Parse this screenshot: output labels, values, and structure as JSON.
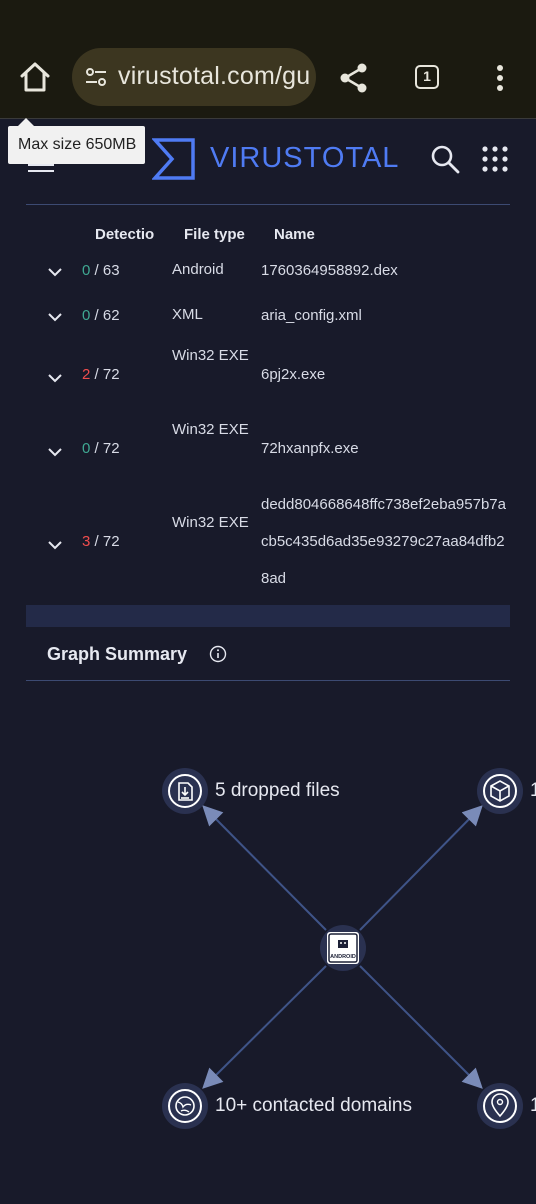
{
  "browser": {
    "url": "virustotal.com/gu",
    "tab_count": "1"
  },
  "tooltip": {
    "text": "Max size 650MB"
  },
  "header": {
    "logo_text": "VIRUSTOTAL"
  },
  "table": {
    "headers": {
      "detection": "Detectio",
      "file_type": "File type",
      "name": "Name"
    },
    "rows": [
      {
        "detections": "0",
        "total": " / 63",
        "file_type": "Android",
        "name": "1760364958892.dex"
      },
      {
        "detections": "0",
        "total": " / 62",
        "file_type": "XML",
        "name": "aria_config.xml"
      },
      {
        "detections": "2",
        "total": " / 72",
        "file_type": "Win32 EXE",
        "name": "6pj2x.exe"
      },
      {
        "detections": "0",
        "total": " / 72",
        "file_type": "Win32 EXE",
        "name": "72hxanpfx.exe"
      },
      {
        "detections": "3",
        "total": " / 72",
        "file_type": "Win32 EXE",
        "name": "dedd804668648ffc738ef2eba957b7acb5c435d6ad35e93279c27aa84dfb28ad"
      }
    ]
  },
  "graph_summary": {
    "title": "Graph Summary",
    "center_node_label": "ANDROID",
    "nodes": [
      {
        "label": "5 dropped files",
        "icon": "download-file-icon"
      },
      {
        "label": "1",
        "icon": "package-box-icon"
      },
      {
        "label": "10+ contacted domains",
        "icon": "globe-link-icon"
      },
      {
        "label": "1",
        "icon": "location-pin-icon"
      }
    ]
  },
  "colors": {
    "accent": "#4f7bf3",
    "clean": "#3fa892",
    "malicious": "#f04d4d",
    "background": "#181a2a"
  }
}
